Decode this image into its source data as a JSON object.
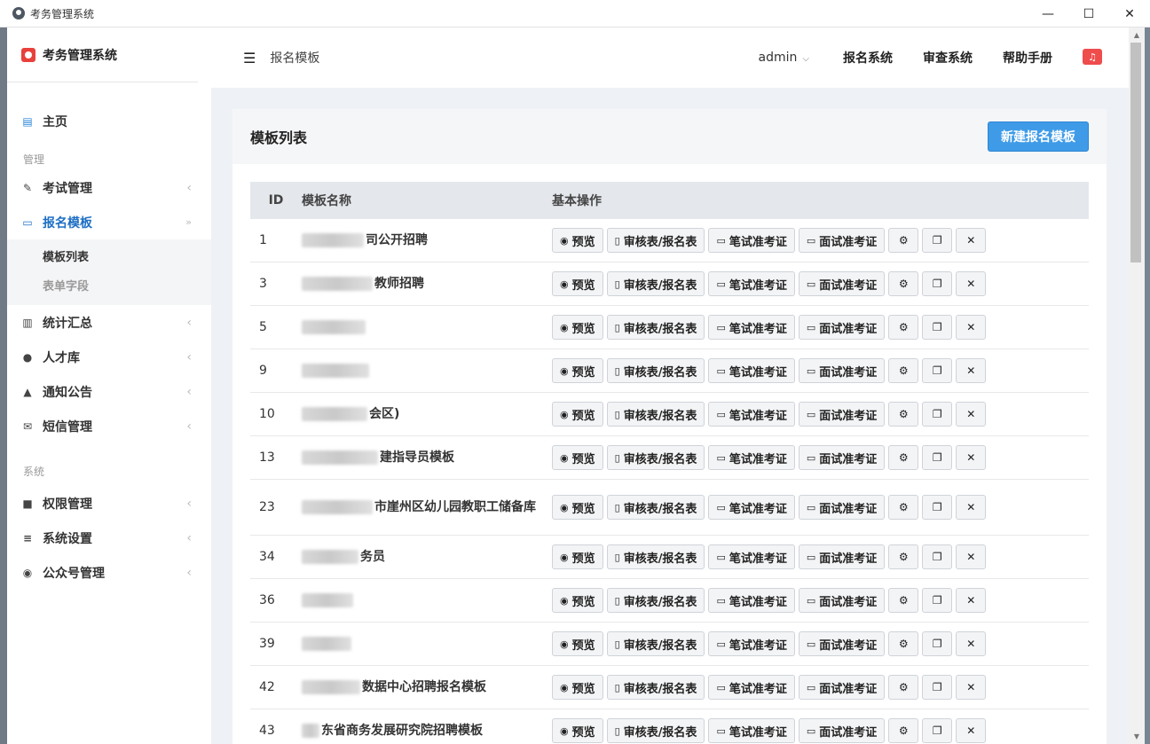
{
  "window": {
    "title": "考务管理系统",
    "minimize": "—",
    "maximize": "☐",
    "close": "✕"
  },
  "sidebar": {
    "brand": "考务管理系统",
    "home": "主页",
    "section_manage": "管理",
    "items_manage": [
      {
        "label": "考试管理",
        "icon": "edit-icon"
      },
      {
        "label": "报名模板",
        "icon": "id-card-icon",
        "active": true
      }
    ],
    "submenu": [
      {
        "label": "模板列表",
        "current": true
      },
      {
        "label": "表单字段",
        "current": false
      }
    ],
    "items_manage2": [
      {
        "label": "统计汇总",
        "icon": "bar-chart-icon"
      },
      {
        "label": "人才库",
        "icon": "users-icon"
      },
      {
        "label": "通知公告",
        "icon": "bell-icon"
      },
      {
        "label": "短信管理",
        "icon": "envelope-icon"
      }
    ],
    "section_system": "系统",
    "items_system": [
      {
        "label": "权限管理",
        "icon": "lock-icon"
      },
      {
        "label": "系统设置",
        "icon": "sliders-icon"
      },
      {
        "label": "公众号管理",
        "icon": "wechat-icon"
      }
    ]
  },
  "header": {
    "breadcrumb": "报名模板",
    "user": "admin",
    "links": [
      "报名系统",
      "审查系统",
      "帮助手册"
    ]
  },
  "card": {
    "title": "模板列表",
    "new_button": "新建报名模板",
    "columns": {
      "id": "ID",
      "name": "模板名称",
      "ops": "基本操作"
    },
    "ops": {
      "preview": "预览",
      "review": "审核表/报名表",
      "written": "笔试准考证",
      "interview": "面试准考证"
    },
    "rows": [
      {
        "id": "1",
        "name": "司公开招聘"
      },
      {
        "id": "3",
        "name": "教师招聘"
      },
      {
        "id": "5",
        "name": ""
      },
      {
        "id": "9",
        "name": ""
      },
      {
        "id": "10",
        "name": "会区)"
      },
      {
        "id": "13",
        "name": "建指导员模板"
      },
      {
        "id": "23",
        "name": "市崖州区幼儿园教职工储备库"
      },
      {
        "id": "34",
        "name": "务员"
      },
      {
        "id": "36",
        "name": ""
      },
      {
        "id": "39",
        "name": ""
      },
      {
        "id": "42",
        "name": "数据中心招聘报名模板"
      },
      {
        "id": "43",
        "name": "东省商务发展研究院招聘模板"
      }
    ]
  }
}
